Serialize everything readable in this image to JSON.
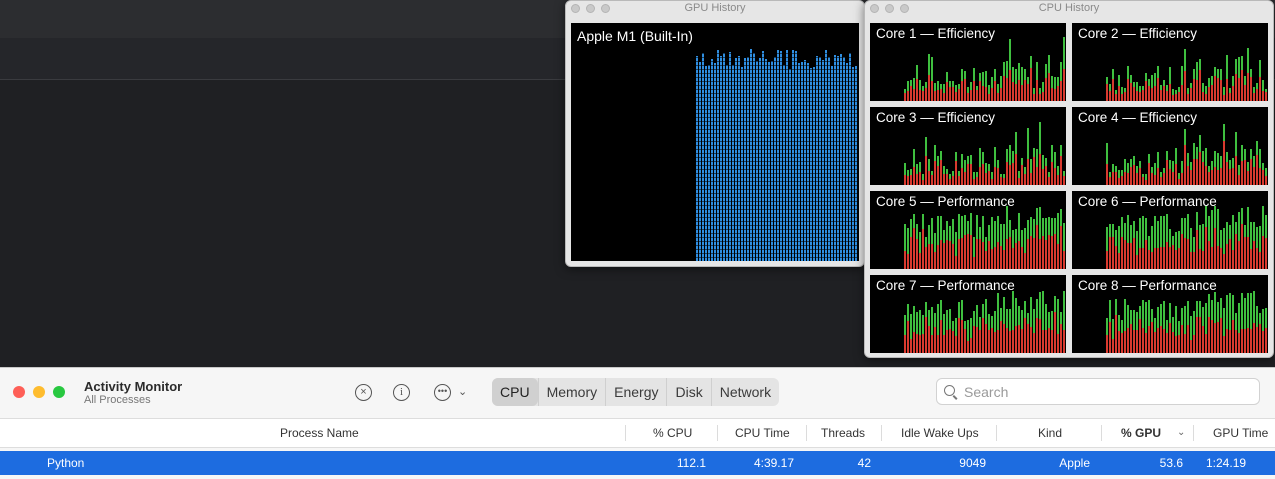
{
  "gpu_window": {
    "title": "GPU History",
    "label": "Apple M1 (Built-In)"
  },
  "cpu_window": {
    "title": "CPU History",
    "cores": [
      "Core 1 — Efficiency",
      "Core 2 — Efficiency",
      "Core 3 — Efficiency",
      "Core 4 — Efficiency",
      "Core 5 — Performance",
      "Core 6 — Performance",
      "Core 7 — Performance",
      "Core 8 — Performance"
    ]
  },
  "app": {
    "title": "Activity Monitor",
    "subtitle": "All Processes"
  },
  "toolbar": {
    "icons": [
      "stop-process-icon",
      "info-icon",
      "more-actions-icon"
    ]
  },
  "tabs": [
    "CPU",
    "Memory",
    "Energy",
    "Disk",
    "Network"
  ],
  "active_tab": "CPU",
  "search": {
    "placeholder": "Search",
    "value": ""
  },
  "columns": [
    "Process Name",
    "% CPU",
    "CPU Time",
    "Threads",
    "Idle Wake Ups",
    "Kind",
    "% GPU",
    "GPU Time"
  ],
  "sort_column": "% GPU",
  "rows": [
    {
      "name": "Python",
      "cpu": "112.1",
      "cpu_time": "4:39.17",
      "threads": "42",
      "idle_wake_ups": "9049",
      "kind": "Apple",
      "gpu": "53.6",
      "gpu_time": "1:24.19"
    }
  ],
  "colors": {
    "gpu_bar": "#2f8ee0",
    "user_cpu": "#3fbf3f",
    "system_cpu": "#d93a2f",
    "selection": "#1d6ce0"
  }
}
